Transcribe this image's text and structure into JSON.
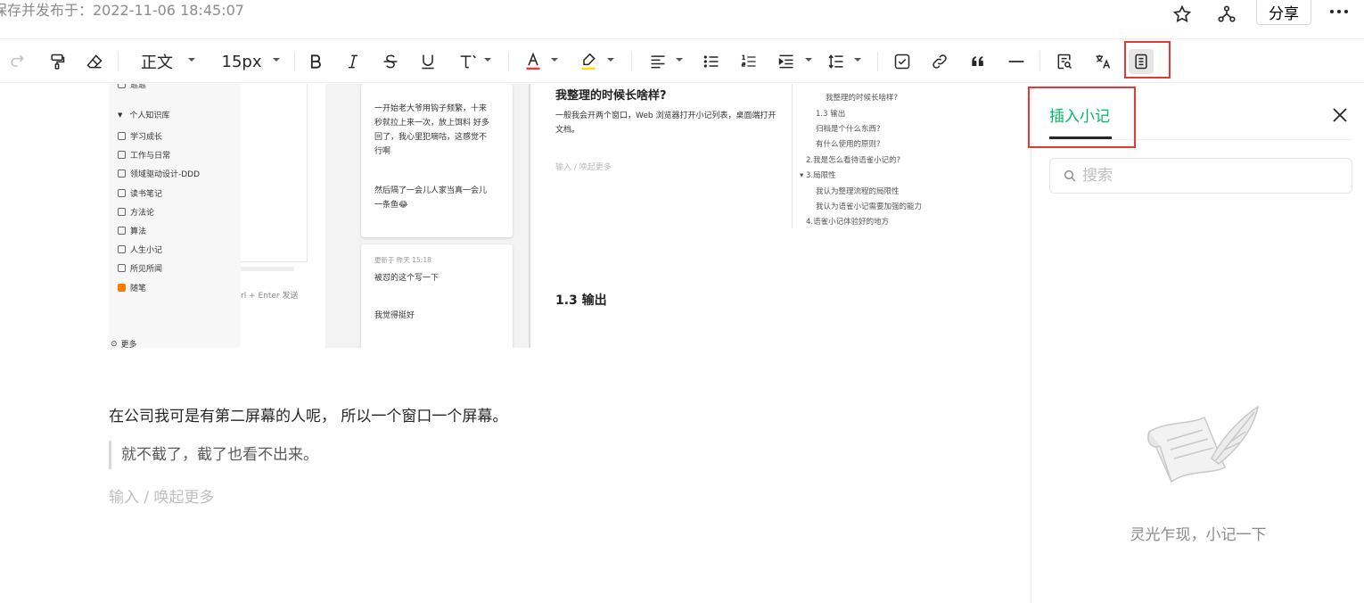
{
  "header": {
    "save_status": "保存并发布于：2022-11-06 18:45:07",
    "share_label": "分享",
    "icons": [
      "star-icon",
      "graph-icon",
      "more-icon"
    ]
  },
  "toolbar": {
    "paragraph_style": "正文",
    "font_size": "15px",
    "icons": [
      "redo-icon",
      "format-painter-icon",
      "eraser-icon",
      "bold-icon",
      "italic-icon",
      "strikethrough-icon",
      "underline-icon",
      "text-more-icon",
      "font-color-icon",
      "highlight-icon",
      "align-icon",
      "bullet-list-icon",
      "ordered-list-icon",
      "indent-icon",
      "line-height-icon",
      "checkbox-icon",
      "link-icon",
      "quote-icon",
      "divider-icon",
      "search-doc-icon",
      "translate-icon",
      "note-icon"
    ]
  },
  "embedded_screenshot": {
    "sidebar": {
      "top_item": "逛逛",
      "section_label": "个人知识库",
      "items": [
        "学习成长",
        "工作与日常",
        "领域驱动设计-DDD",
        "读书笔记",
        "方法论",
        "算法",
        "人生小记",
        "所见所闻",
        "随笔"
      ],
      "more_label": "更多"
    },
    "mid_hint": "rl + Enter 发送",
    "cards": [
      {
        "lines": [
          "一开始老大爷用钩子频繁，十来",
          "秒就拉上来一次，放上饵料 好多",
          "回了，我心里犯嘀咕，这感觉不",
          "行啊"
        ]
      },
      {
        "lines": [
          "然后隔了一会儿人家当真一会儿",
          "一条鱼😂"
        ]
      }
    ],
    "card2": {
      "meta": "更新于 昨天 15:18",
      "line1": "被怼的这个写一下",
      "line2": "我觉得挺好"
    },
    "doc": {
      "heading1": "我整理的时候长啥样?",
      "paragraph": "一般我会开两个窗口，Web 浏览器打开小记列表，桌面端打开文档。",
      "placeholder": "输入 / 唤起更多",
      "heading2": "1.3 输出"
    },
    "toc": [
      "我整理的时候长啥样?",
      "1.3 输出",
      "归档是个什么东西?",
      "有什么使用的原则?",
      "2.我是怎么看待语雀小记的?",
      "3.局限性",
      "我认为整理流程的局限性",
      "我认为语雀小记需要加强的能力",
      "4.语雀小记体验好的地方"
    ]
  },
  "editor": {
    "paragraph": "在公司我可是有第二屏幕的人呢， 所以一个窗口一个屏幕。",
    "quote": "就不截了，截了也看不出来。",
    "placeholder": "输入 / 唤起更多"
  },
  "panel": {
    "title": "插入小记",
    "search_placeholder": "搜索",
    "empty_text": "灵光乍现，小记一下"
  },
  "colors": {
    "accent": "#00b96b",
    "highlight_box": "#e53935"
  }
}
